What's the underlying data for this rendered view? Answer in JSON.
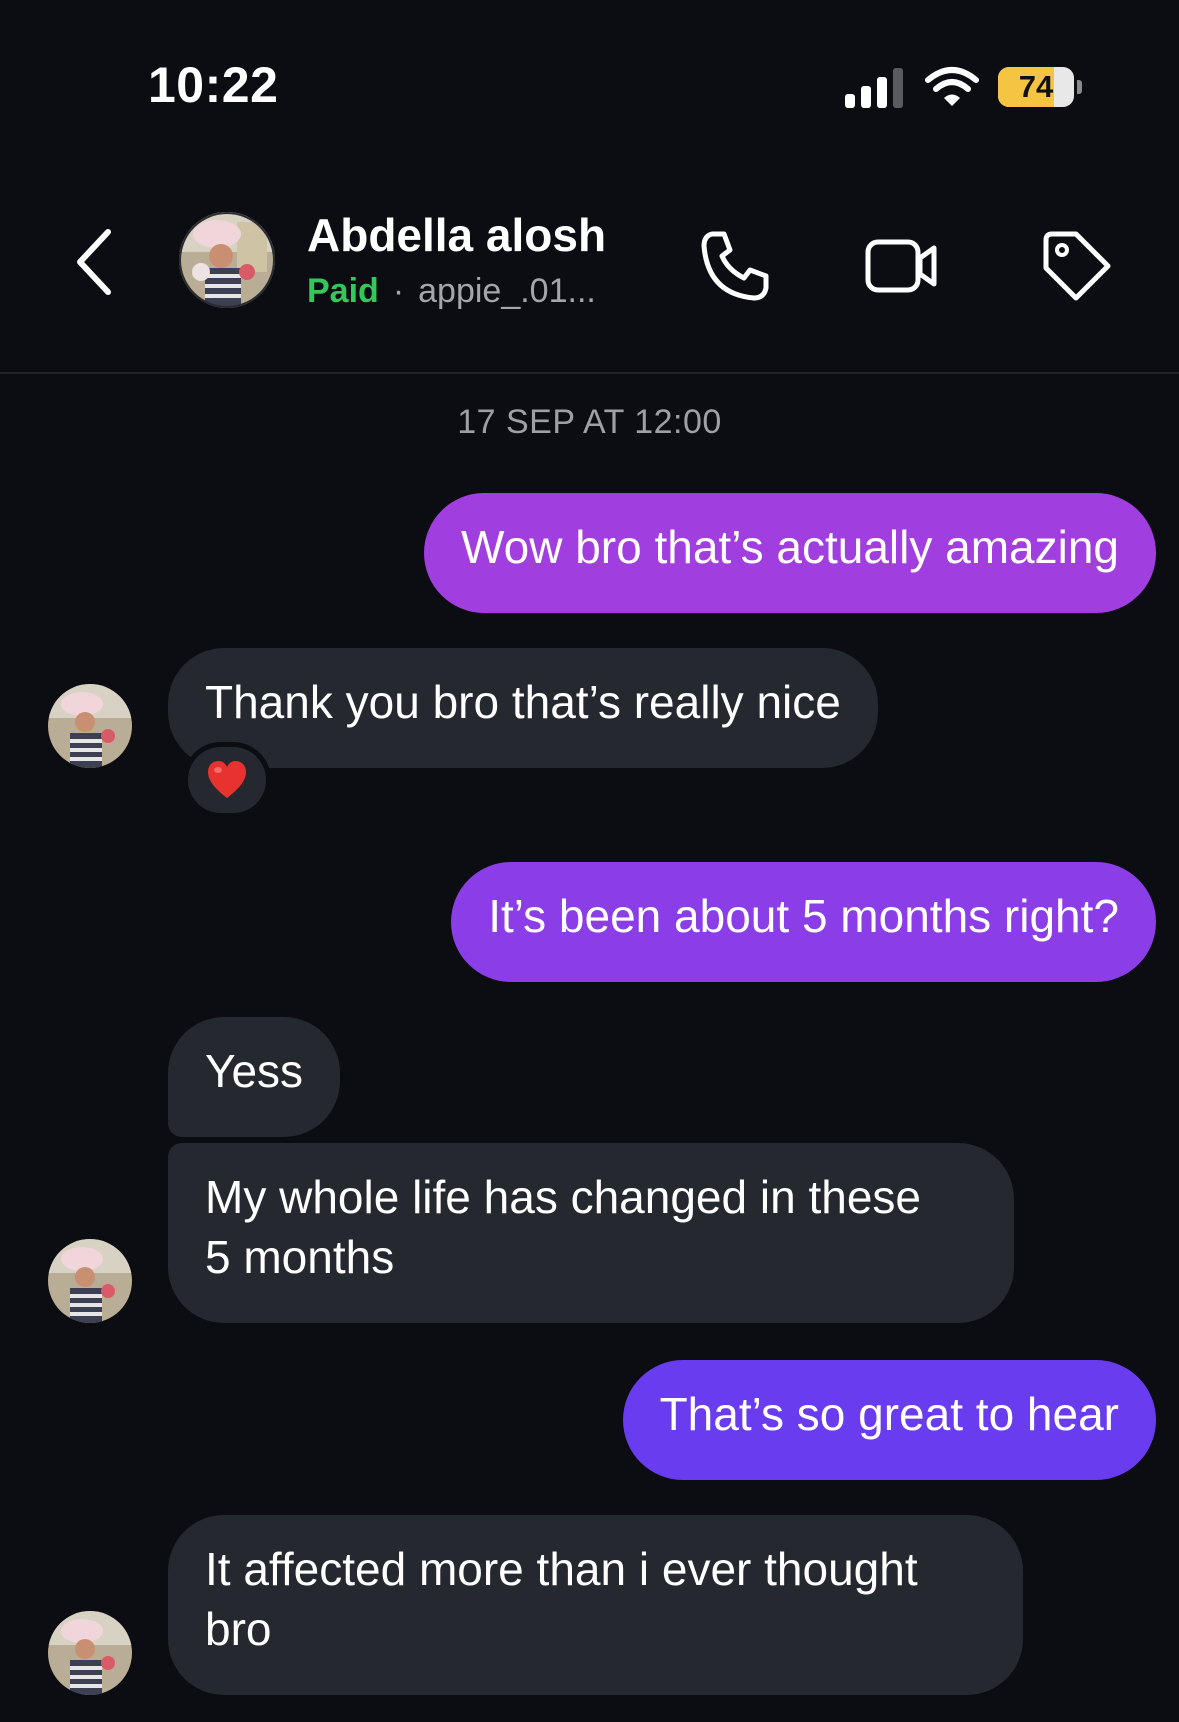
{
  "status_bar": {
    "time": "10:22",
    "battery_level": "74",
    "battery_fraction": 0.74,
    "icons": [
      "signal-icon",
      "wifi-icon",
      "battery-charging-icon"
    ]
  },
  "header": {
    "contact_name": "Abdella alosh",
    "status_label": "Paid",
    "username": "appie_.01...",
    "icons": [
      "back-chevron-icon",
      "phone-icon",
      "video-camera-icon",
      "tag-icon"
    ]
  },
  "conversation": {
    "timestamp": "17 SEP AT 12:00",
    "messages": [
      {
        "side": "sent",
        "text": "Wow bro that’s actually amazing",
        "color": "#a13ee0"
      },
      {
        "side": "received",
        "text": "Thank you bro that’s really nice",
        "reaction": "red-heart-icon"
      },
      {
        "side": "sent",
        "text": "It’s been about 5 months right?",
        "color": "#8b3de8"
      },
      {
        "side": "received",
        "text": "Yess"
      },
      {
        "side": "received",
        "text_line1": "My whole life has changed in these",
        "text_line2": "5 months"
      },
      {
        "side": "sent",
        "text": "That’s so great to hear",
        "color": "#6a3cef"
      },
      {
        "side": "received",
        "text_line1": "It affected more than i ever thought",
        "text_line2": "bro"
      }
    ]
  },
  "colors": {
    "background": "#0c0d12",
    "received_bubble": "#26282f",
    "paid_green": "#34c759",
    "sent_gradient_top": "#a13ee0",
    "sent_gradient_bottom": "#6a3cef"
  }
}
